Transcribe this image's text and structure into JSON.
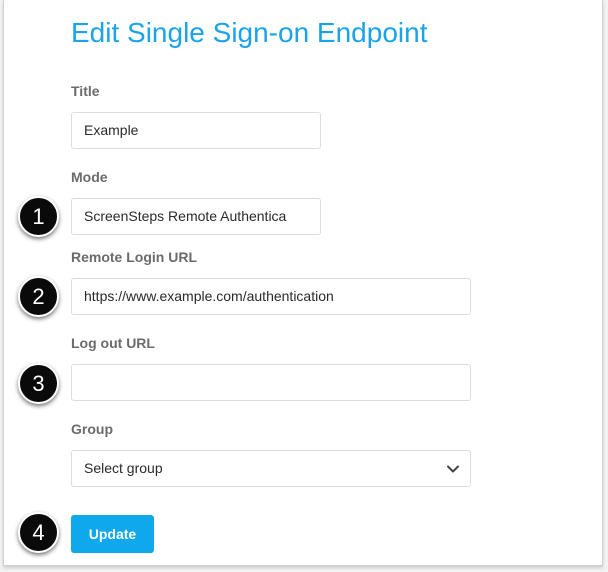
{
  "page": {
    "title": "Edit Single Sign-on Endpoint"
  },
  "form": {
    "title_label": "Title",
    "title_value": "Example",
    "mode_label": "Mode",
    "mode_value": "ScreenSteps Remote Authentica",
    "remote_login_label": "Remote Login URL",
    "remote_login_value": "https://www.example.com/authentication",
    "logout_label": "Log out URL",
    "logout_value": "",
    "group_label": "Group",
    "group_value": "Select group",
    "update_label": "Update"
  },
  "callouts": [
    "1",
    "2",
    "3",
    "4"
  ],
  "colors": {
    "accent": "#1aa3e8",
    "button": "#0fa8ec",
    "badge": "#0a0a0a"
  },
  "icons": {
    "select_caret": "chevron-down-icon"
  }
}
